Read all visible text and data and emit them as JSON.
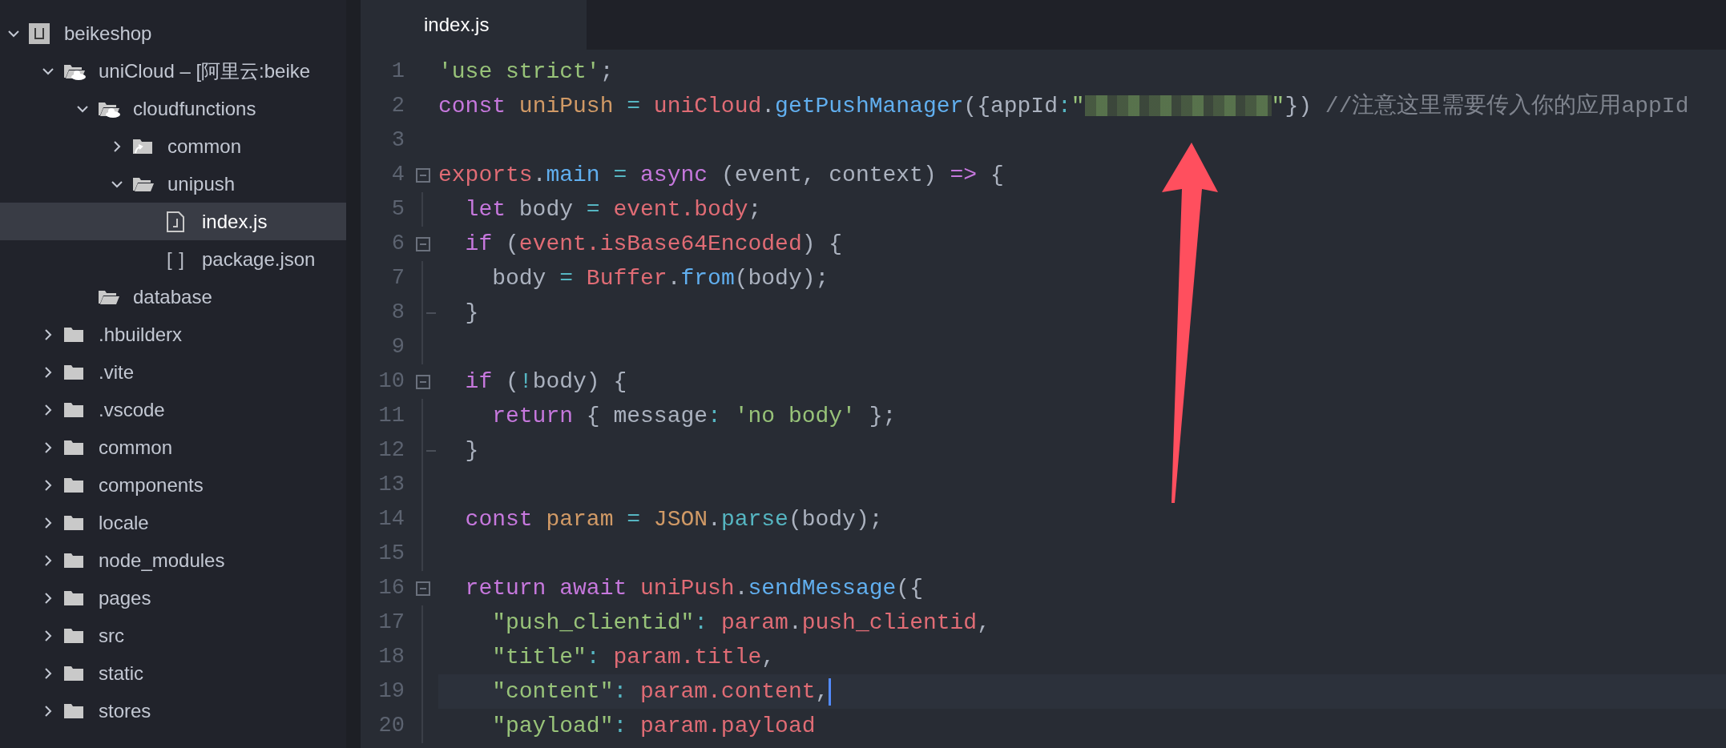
{
  "sidebar": {
    "tree": [
      {
        "kind": "project",
        "label": "beikeshop",
        "expanded": true,
        "selected": false,
        "children": [
          {
            "kind": "cloud-folder",
            "label": "uniCloud – [阿里云:beike",
            "expanded": true,
            "selected": false,
            "children": [
              {
                "kind": "cloud-folder",
                "label": "cloudfunctions",
                "expanded": true,
                "selected": false,
                "children": [
                  {
                    "kind": "linked-folder",
                    "label": "common",
                    "expanded": false,
                    "selected": false
                  },
                  {
                    "kind": "folder",
                    "label": "unipush",
                    "expanded": true,
                    "selected": false,
                    "children": [
                      {
                        "kind": "js-file",
                        "label": "index.js",
                        "selected": true
                      },
                      {
                        "kind": "json-file",
                        "glyph": "[ ]",
                        "label": "package.json",
                        "selected": false
                      }
                    ]
                  }
                ]
              },
              {
                "kind": "folder",
                "label": "database",
                "selected": false
              }
            ]
          },
          {
            "kind": "folder",
            "label": ".hbuilderx",
            "expanded": false,
            "selected": false
          },
          {
            "kind": "folder",
            "label": ".vite",
            "expanded": false,
            "selected": false
          },
          {
            "kind": "folder",
            "label": ".vscode",
            "expanded": false,
            "selected": false
          },
          {
            "kind": "folder",
            "label": "common",
            "expanded": false,
            "selected": false
          },
          {
            "kind": "folder",
            "label": "components",
            "expanded": false,
            "selected": false
          },
          {
            "kind": "folder",
            "label": "locale",
            "expanded": false,
            "selected": false
          },
          {
            "kind": "folder",
            "label": "node_modules",
            "expanded": false,
            "selected": false
          },
          {
            "kind": "folder",
            "label": "pages",
            "expanded": false,
            "selected": false
          },
          {
            "kind": "folder",
            "label": "src",
            "expanded": false,
            "selected": false
          },
          {
            "kind": "folder",
            "label": "static",
            "expanded": false,
            "selected": false
          },
          {
            "kind": "folder",
            "label": "stores",
            "expanded": false,
            "selected": false
          }
        ]
      }
    ]
  },
  "editor": {
    "tabs": [
      {
        "label": "index.js",
        "selected": true
      }
    ],
    "lines": [
      {
        "number": "1",
        "current": false,
        "fold_start": false,
        "fold_end": false,
        "tokens": [
          {
            "kind": "str",
            "text": "'use strict'"
          },
          {
            "kind": "plain",
            "text": ";"
          }
        ]
      },
      {
        "number": "2",
        "current": false,
        "fold_start": false,
        "fold_end": false,
        "tokens": [
          {
            "kind": "kw",
            "text": "const "
          },
          {
            "kind": "var",
            "text": "uniPush "
          },
          {
            "kind": "op",
            "text": "= "
          },
          {
            "kind": "red",
            "text": "uniCloud"
          },
          {
            "kind": "plain",
            "text": "."
          },
          {
            "kind": "fn",
            "text": "getPushManager"
          },
          {
            "kind": "plain",
            "text": "({appId"
          },
          {
            "kind": "op",
            "text": ":"
          },
          {
            "kind": "str",
            "text": "\""
          },
          {
            "kind": "redacted"
          },
          {
            "kind": "str",
            "text": "\""
          },
          {
            "kind": "plain",
            "text": "}) "
          },
          {
            "kind": "comment",
            "text": "//注意这里需要传入你的应用appId"
          }
        ]
      },
      {
        "number": "3",
        "current": false,
        "fold_start": false,
        "fold_end": false
      },
      {
        "number": "4",
        "current": false,
        "fold_start": true,
        "fold_end": false,
        "tokens": [
          {
            "kind": "red",
            "text": "exports"
          },
          {
            "kind": "plain",
            "text": "."
          },
          {
            "kind": "fn",
            "text": "main "
          },
          {
            "kind": "op",
            "text": "= "
          },
          {
            "kind": "kw",
            "text": "async"
          },
          {
            "kind": "plain",
            "text": " (event, context) "
          },
          {
            "kind": "kw",
            "text": "=>"
          },
          {
            "kind": "plain",
            "text": " {"
          }
        ]
      },
      {
        "number": "5",
        "current": false,
        "fold_start": false,
        "fold_end": false,
        "tokens": [
          {
            "kind": "kw",
            "text": "  let"
          },
          {
            "kind": "plain",
            "text": " body "
          },
          {
            "kind": "op",
            "text": "= "
          },
          {
            "kind": "red",
            "text": "event.body"
          },
          {
            "kind": "plain",
            "text": ";"
          }
        ]
      },
      {
        "number": "6",
        "current": false,
        "fold_start": true,
        "fold_end": false,
        "tokens": [
          {
            "kind": "kw",
            "text": "  if"
          },
          {
            "kind": "plain",
            "text": " ("
          },
          {
            "kind": "red",
            "text": "event.isBase64Encoded"
          },
          {
            "kind": "plain",
            "text": ") {"
          }
        ]
      },
      {
        "number": "7",
        "current": false,
        "fold_start": false,
        "fold_end": false,
        "tokens": [
          {
            "kind": "plain",
            "text": "    body "
          },
          {
            "kind": "op",
            "text": "= "
          },
          {
            "kind": "red",
            "text": "Buffer"
          },
          {
            "kind": "plain",
            "text": "."
          },
          {
            "kind": "fn",
            "text": "from"
          },
          {
            "kind": "plain",
            "text": "(body);"
          }
        ]
      },
      {
        "number": "8",
        "current": false,
        "fold_start": false,
        "fold_end": true,
        "tokens": [
          {
            "kind": "plain",
            "text": "  }"
          }
        ]
      },
      {
        "number": "9",
        "current": false,
        "fold_start": false,
        "fold_end": false
      },
      {
        "number": "10",
        "current": false,
        "fold_start": true,
        "fold_end": false,
        "tokens": [
          {
            "kind": "kw",
            "text": "  if"
          },
          {
            "kind": "plain",
            "text": " ("
          },
          {
            "kind": "op",
            "text": "!"
          },
          {
            "kind": "plain",
            "text": "body) {"
          }
        ]
      },
      {
        "number": "11",
        "current": false,
        "fold_start": false,
        "fold_end": false,
        "tokens": [
          {
            "kind": "kw",
            "text": "    return"
          },
          {
            "kind": "plain",
            "text": " { message"
          },
          {
            "kind": "op",
            "text": ": "
          },
          {
            "kind": "str",
            "text": "'no body'"
          },
          {
            "kind": "plain",
            "text": " };"
          }
        ]
      },
      {
        "number": "12",
        "current": false,
        "fold_start": false,
        "fold_end": true,
        "tokens": [
          {
            "kind": "plain",
            "text": "  }"
          }
        ]
      },
      {
        "number": "13",
        "current": false,
        "fold_start": false,
        "fold_end": false
      },
      {
        "number": "14",
        "current": false,
        "fold_start": false,
        "fold_end": false,
        "tokens": [
          {
            "kind": "kw",
            "text": "  const "
          },
          {
            "kind": "var",
            "text": "param "
          },
          {
            "kind": "op",
            "text": "= "
          },
          {
            "kind": "var",
            "text": "JSON"
          },
          {
            "kind": "plain",
            "text": "."
          },
          {
            "kind": "cyan",
            "text": "parse"
          },
          {
            "kind": "plain",
            "text": "(body);"
          }
        ]
      },
      {
        "number": "15",
        "current": false,
        "fold_start": false,
        "fold_end": false
      },
      {
        "number": "16",
        "current": false,
        "fold_start": true,
        "fold_end": false,
        "tokens": [
          {
            "kind": "kw",
            "text": "  return await "
          },
          {
            "kind": "red",
            "text": "uniPush"
          },
          {
            "kind": "plain",
            "text": "."
          },
          {
            "kind": "fn",
            "text": "sendMessage"
          },
          {
            "kind": "plain",
            "text": "({"
          }
        ]
      },
      {
        "number": "17",
        "current": false,
        "fold_start": false,
        "fold_end": false,
        "tokens": [
          {
            "kind": "str",
            "text": "    \"push_clientid\""
          },
          {
            "kind": "op",
            "text": ": "
          },
          {
            "kind": "red",
            "text": "param"
          },
          {
            "kind": "plain",
            "text": "."
          },
          {
            "kind": "red",
            "text": "push_clientid"
          },
          {
            "kind": "plain",
            "text": ","
          }
        ]
      },
      {
        "number": "18",
        "current": false,
        "fold_start": false,
        "fold_end": false,
        "tokens": [
          {
            "kind": "str",
            "text": "    \"title\""
          },
          {
            "kind": "op",
            "text": ": "
          },
          {
            "kind": "red",
            "text": "param.title"
          },
          {
            "kind": "plain",
            "text": ","
          }
        ]
      },
      {
        "number": "19",
        "current": true,
        "fold_start": false,
        "fold_end": false,
        "tokens": [
          {
            "kind": "str",
            "text": "    \"content\""
          },
          {
            "kind": "op",
            "text": ": "
          },
          {
            "kind": "red",
            "text": "param.content"
          },
          {
            "kind": "plain",
            "text": ","
          }
        ]
      },
      {
        "number": "20",
        "current": false,
        "fold_start": false,
        "fold_end": false,
        "tokens": [
          {
            "kind": "str",
            "text": "    \"payload\""
          },
          {
            "kind": "op",
            "text": ": "
          },
          {
            "kind": "red",
            "text": "param.payload"
          }
        ]
      }
    ]
  },
  "annotation": {
    "kind": "arrow"
  }
}
